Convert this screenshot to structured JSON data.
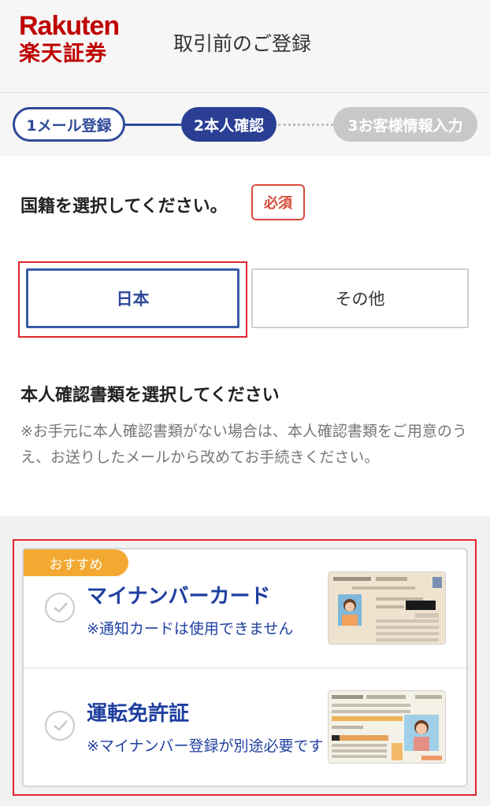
{
  "header": {
    "logo_en": "Rakuten",
    "logo_ja": "楽天証券",
    "title": "取引前のご登録"
  },
  "steps": [
    {
      "label": "1メール登録",
      "state": "done"
    },
    {
      "label": "2本人確認",
      "state": "current"
    },
    {
      "label": "3お客様情報入力",
      "state": "upcoming"
    }
  ],
  "nationality": {
    "question": "国籍を選択してください。",
    "required_badge": "必須",
    "options": [
      "日本",
      "その他"
    ],
    "selected": "日本"
  },
  "documents": {
    "title": "本人確認書類を選択してください",
    "note": "※お手元に本人確認書類がない場合は、本人確認書類をご用意のうえ、お送りしたメールから改めてお手続きください。",
    "recommended_badge": "おすすめ",
    "options": [
      {
        "title": "マイナンバーカード",
        "sub": "※通知カードは使用できません",
        "icon": "my-number-card-image"
      },
      {
        "title": "運転免許証",
        "sub": "※マイナンバー登録が別途必要です",
        "icon": "drivers-license-image"
      }
    ]
  },
  "colors": {
    "brand_red": "#bf0000",
    "primary_blue": "#2a3f94",
    "recommend_orange": "#f3a931",
    "required_red": "#d64c3a"
  }
}
